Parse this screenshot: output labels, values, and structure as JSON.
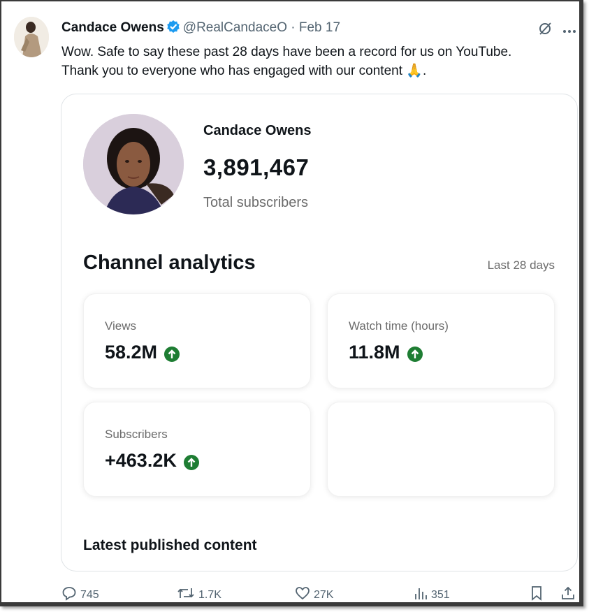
{
  "tweet": {
    "author_name": "Candace Owens",
    "handle": "@RealCandaceO",
    "separator": "·",
    "date": "Feb 17",
    "text_line1": "Wow. Safe to say these past 28 days have been a record for us on YouTube.",
    "text_line2": "Thank you to everyone who has engaged with our content",
    "text_end": "🙏."
  },
  "card": {
    "channel_name": "Candace Owens",
    "subscriber_count": "3,891,467",
    "subscriber_label": "Total subscribers",
    "analytics_title": "Channel analytics",
    "range_label": "Last 28 days",
    "stats": [
      {
        "label": "Views",
        "value": "58.2M"
      },
      {
        "label": "Watch time (hours)",
        "value": "11.8M"
      },
      {
        "label": "Subscribers",
        "value": "+463.2K"
      }
    ],
    "latest_label": "Latest published content"
  },
  "actions": {
    "replies": "745",
    "retweets": "1.7K",
    "likes": "27K",
    "views": "351"
  },
  "colors": {
    "verified": "#1d9bf0",
    "up_arrow": "#1e7d33",
    "muted": "#536471"
  }
}
